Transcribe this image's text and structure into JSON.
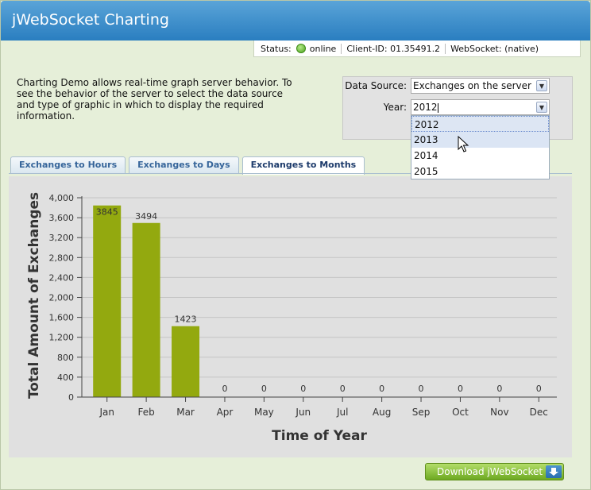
{
  "app": {
    "title": "jWebSocket Charting"
  },
  "status": {
    "status_label": "Status:",
    "status_value": "online",
    "client_label": "Client-ID:",
    "client_value": "01.35491.2",
    "ws_label": "WebSocket:",
    "ws_value": "(native)"
  },
  "intro": {
    "text": "Charting Demo allows real-time graph server behavior. To see the behavior of the server to select the data source and type of graphic in which to display the required information."
  },
  "controls": {
    "data_source_label": "Data Source:",
    "data_source_value": "Exchanges on the server",
    "year_label": "Year:",
    "year_value": "2012",
    "year_options": [
      "2012",
      "2013",
      "2014",
      "2015"
    ],
    "year_selected": "2012",
    "year_hovered": "2013"
  },
  "tabs": [
    {
      "label": "Exchanges to Hours",
      "active": false
    },
    {
      "label": "Exchanges to Days",
      "active": false
    },
    {
      "label": "Exchanges to Months",
      "active": true
    }
  ],
  "chart_data": {
    "type": "bar",
    "categories": [
      "Jan",
      "Feb",
      "Mar",
      "Apr",
      "May",
      "Jun",
      "Jul",
      "Aug",
      "Sep",
      "Oct",
      "Nov",
      "Dec"
    ],
    "values": [
      3845,
      3494,
      1423,
      0,
      0,
      0,
      0,
      0,
      0,
      0,
      0,
      0
    ],
    "data_labels": [
      "3845",
      "3494",
      "1423",
      "0",
      "0",
      "0",
      "0",
      "0",
      "0",
      "0",
      "0",
      "0"
    ],
    "xlabel": "Time of Year",
    "ylabel": "Total Amount of Exchanges",
    "ylim": [
      0,
      4000
    ],
    "yticks": [
      "0",
      "400",
      "800",
      "1,200",
      "1,600",
      "2,000",
      "2,400",
      "2,800",
      "3,200",
      "3,600",
      "4,000"
    ],
    "ytick_values": [
      0,
      400,
      800,
      1200,
      1600,
      2000,
      2400,
      2800,
      3200,
      3600,
      4000
    ],
    "grid": true,
    "bar_color": "#93a90f"
  },
  "footer": {
    "download_label": "Download jWebSocket"
  },
  "colors": {
    "header": "#2a7ec0",
    "background": "#e6efd9",
    "online": "#4aa31c"
  }
}
